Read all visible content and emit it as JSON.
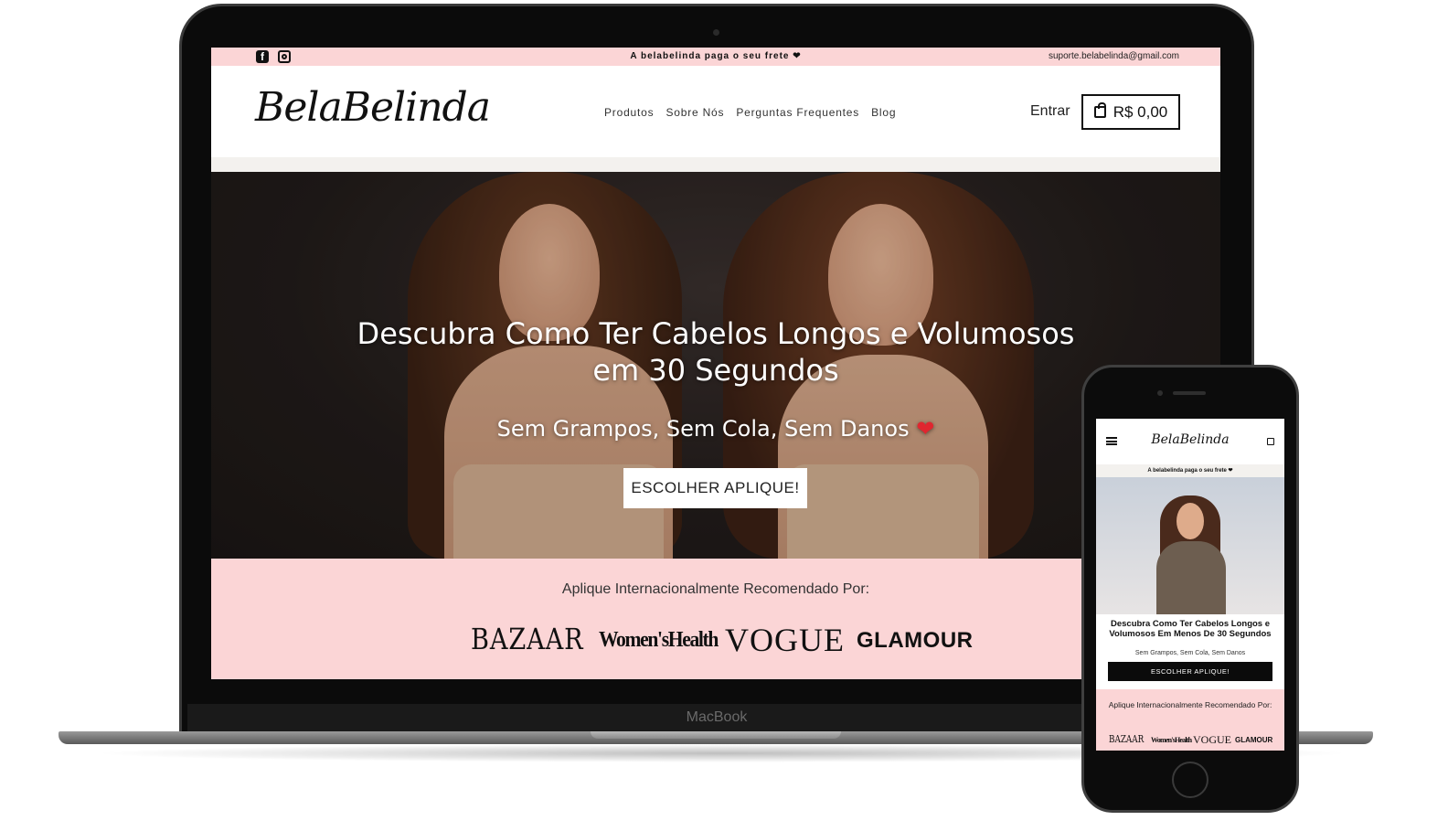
{
  "laptop": {
    "brand_label": "MacBook",
    "topbar": {
      "promo_text": "A belabelinda paga o seu frete ❤",
      "support_email": "suporte.belabelinda@gmail.com",
      "facebook_glyph": "f"
    },
    "header": {
      "logo_text": "BelaBelinda",
      "nav": [
        "Produtos",
        "Sobre Nós",
        "Perguntas Frequentes",
        "Blog"
      ],
      "login_label": "Entrar",
      "cart_amount": "R$ 0,00"
    },
    "hero": {
      "title_line1": "Descubra Como Ter Cabelos Longos e Volumosos",
      "title_line2": "em 30 Segundos",
      "subtitle": "Sem Grampos, Sem Cola, Sem Danos",
      "heart_glyph": "❤",
      "cta_label": "ESCOLHER APLIQUE!"
    },
    "press": {
      "title": "Aplique Internacionalmente Recomendado Por:",
      "logos": [
        "BAZAAR",
        "Women'sHealth",
        "VOGUE",
        "GLAMOUR"
      ]
    }
  },
  "phone": {
    "logo_text": "BelaBelinda",
    "promo_text": "A belabelinda paga o seu frete ❤",
    "hero_title": "Descubra Como Ter Cabelos Longos e Volumosos Em Menos De 30 Segundos",
    "hero_subtitle": "Sem Grampos, Sem Cola, Sem Danos",
    "cta_label": "ESCOLHER APLIQUE!",
    "press_title": "Aplique Internacionalmente Recomendado Por:",
    "logos": [
      "BAZAAR",
      "Women'sHealth",
      "VOGUE",
      "GLAMOUR"
    ]
  },
  "colors": {
    "pink_band": "#fbd5d6",
    "heart_red": "#e0262f",
    "device_black": "#0b0b0b"
  },
  "icons": {
    "facebook": "facebook-icon",
    "instagram": "instagram-icon",
    "cart": "shopping-bag-icon",
    "heart": "heart-icon",
    "menu": "hamburger-menu-icon"
  }
}
